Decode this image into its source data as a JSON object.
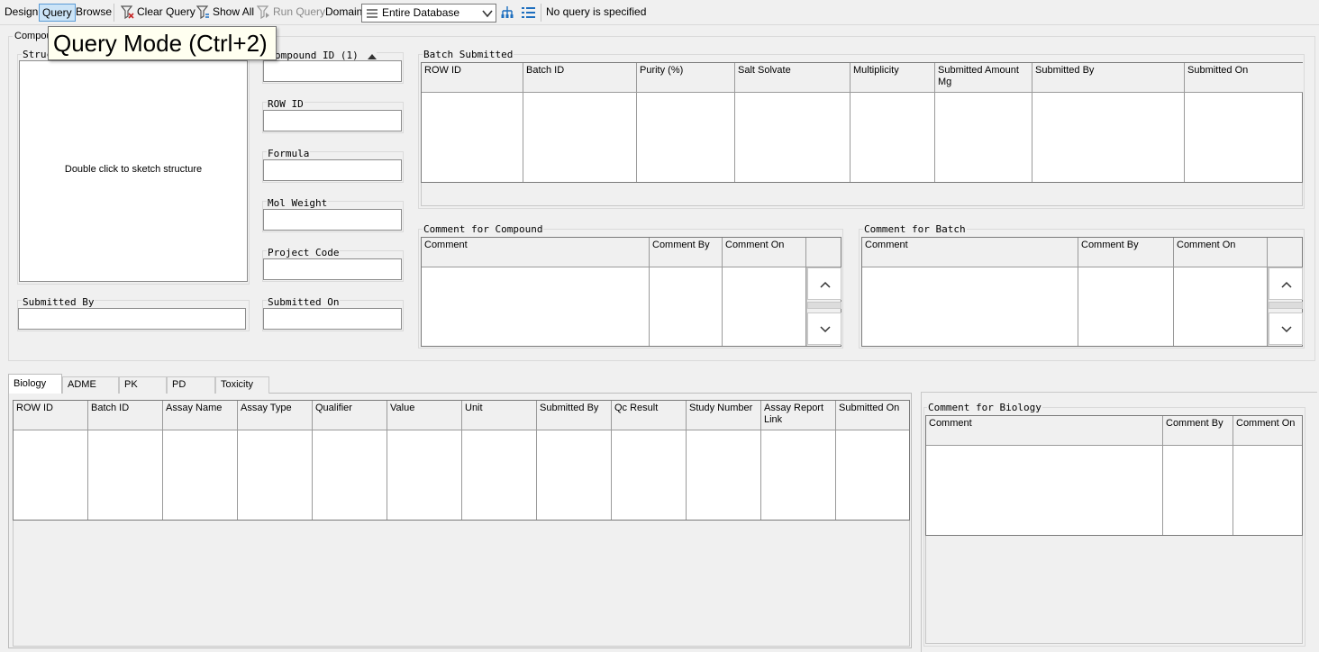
{
  "toolbar": {
    "design": "Design",
    "query": "Query",
    "browse": "Browse",
    "clear_query": "Clear Query",
    "show_all": "Show All",
    "run_query": "Run Query",
    "domain_label": "Domain:",
    "domain_value": "Entire Database",
    "status": "No query is specified"
  },
  "tooltip": "Query Mode (Ctrl+2)",
  "compound_group": {
    "legend": "Compou",
    "structure_legend": "Struc",
    "sketch_hint": "Double click to sketch structure",
    "fields": {
      "compound_id": "ompound ID (1)",
      "row_id": "ROW ID",
      "formula": "Formula",
      "mol_weight": "Mol Weight",
      "project_code": "Project Code",
      "submitted_by": "Submitted By",
      "submitted_on": "Submitted On"
    }
  },
  "batch_submitted": {
    "legend": "Batch Submitted",
    "columns": [
      "ROW ID",
      "Batch ID",
      "Purity (%)",
      "Salt Solvate",
      "Multiplicity",
      "Submitted Amount Mg",
      "Submitted By",
      "Submitted On"
    ]
  },
  "comment_compound": {
    "legend": "Comment for Compound",
    "columns": [
      "Comment",
      "Comment By",
      "Comment On"
    ]
  },
  "comment_batch": {
    "legend": "Comment for Batch",
    "columns": [
      "Comment",
      "Comment By",
      "Comment On"
    ]
  },
  "tabs": [
    "Biology",
    "ADME",
    "PK",
    "PD",
    "Toxicity"
  ],
  "biology_table": {
    "columns": [
      "ROW ID",
      "Batch ID",
      "Assay Name",
      "Assay Type",
      "Qualifier",
      "Value",
      "Unit",
      "Submitted By",
      "Qc Result",
      "Study Number",
      "Assay Report Link",
      "Submitted On"
    ]
  },
  "comment_biology": {
    "legend": "Comment for Biology",
    "columns": [
      "Comment",
      "Comment By",
      "Comment On"
    ]
  },
  "icons": {
    "clear_query": "funnel-x-icon",
    "show_all": "funnel-icon",
    "run_query": "funnel-run-icon",
    "domain": "list-icon",
    "tree": "tree-icon",
    "list": "list-view-icon"
  },
  "colors": {
    "active_button_bg": "#cce4f7",
    "active_button_border": "#5a9bd5",
    "tooltip_bg": "#fffff0",
    "clear_query_icon": "#c62828",
    "accent_icon": "#1e6fbf"
  }
}
